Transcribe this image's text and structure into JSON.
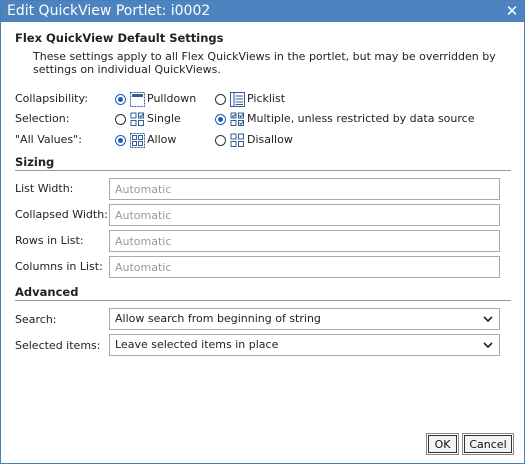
{
  "dialog": {
    "title": "Edit QuickView Portlet: i0002",
    "close_glyph": "✕"
  },
  "defaults": {
    "heading": "Flex QuickView Default Settings",
    "note": "These settings apply to all Flex QuickViews in the portlet, but may be overridden by settings on individual QuickViews."
  },
  "collapsibility": {
    "label": "Collapsibility:",
    "options": [
      {
        "label": "Pulldown",
        "icon": "pulldown-icon",
        "checked": true
      },
      {
        "label": "Picklist",
        "icon": "picklist-icon",
        "checked": false
      }
    ]
  },
  "selection": {
    "label": "Selection:",
    "options": [
      {
        "label": "Single",
        "icon": "single-select-icon",
        "checked": false
      },
      {
        "label": "Multiple, unless restricted by data source",
        "icon": "multi-select-icon",
        "checked": true
      }
    ]
  },
  "all_values": {
    "label": "\"All Values\":",
    "options": [
      {
        "label": "Allow",
        "icon": "allow-all-icon",
        "checked": true
      },
      {
        "label": "Disallow",
        "icon": "disallow-all-icon",
        "checked": false
      }
    ]
  },
  "sizing": {
    "heading": "Sizing",
    "fields": [
      {
        "label": "List Width:",
        "placeholder": "Automatic",
        "value": ""
      },
      {
        "label": "Collapsed Width:",
        "placeholder": "Automatic",
        "value": ""
      },
      {
        "label": "Rows in List:",
        "placeholder": "Automatic",
        "value": ""
      },
      {
        "label": "Columns in List:",
        "placeholder": "Automatic",
        "value": ""
      }
    ]
  },
  "advanced": {
    "heading": "Advanced",
    "search": {
      "label": "Search:",
      "value": "Allow search from beginning of string"
    },
    "selected_items": {
      "label": "Selected items:",
      "value": "Leave selected items in place"
    }
  },
  "buttons": {
    "ok": "OK",
    "cancel": "Cancel"
  },
  "colors": {
    "titlebar": "#4d84bf",
    "radio_accent": "#1a5fb4",
    "icon_blue": "#2f5f96"
  }
}
